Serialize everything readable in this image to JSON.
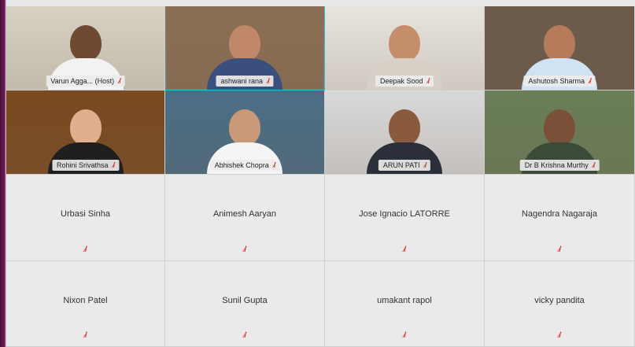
{
  "participants": [
    {
      "name": "Varun Agga... (Host)",
      "muted_icon": "mic-muted-icon",
      "video": true,
      "active": false,
      "bg": "#d8d2c4",
      "shirt": "#f2f2f2",
      "skin": "#6f4a33"
    },
    {
      "name": "ashwani rana",
      "muted_icon": "mic-muted-icon",
      "video": true,
      "active": true,
      "bg": "#8b6f55",
      "shirt": "#3b4f7d",
      "skin": "#c08868"
    },
    {
      "name": "Deepak Sood",
      "muted_icon": "mic-muted-icon",
      "video": true,
      "active": false,
      "bg": "#e7e4de",
      "shirt": "#d7d0c7",
      "skin": "#c58e6a"
    },
    {
      "name": "Ashutosh Sharma",
      "muted_icon": "mic-muted-icon",
      "video": true,
      "active": false,
      "bg": "#6c5a4b",
      "shirt": "#cfe3f5",
      "skin": "#b57b5b"
    },
    {
      "name": "Rohini Srivathsa",
      "muted_icon": "mic-muted-icon",
      "video": true,
      "active": false,
      "bg": "#7a4a20",
      "shirt": "#1f1f1f",
      "skin": "#e0b08e"
    },
    {
      "name": "Abhishek Chopra",
      "muted_icon": "mic-muted-icon",
      "video": true,
      "active": false,
      "bg": "#4b6e86",
      "shirt": "#f5f5f5",
      "skin": "#c89a78"
    },
    {
      "name": "ARUN PATI",
      "muted_icon": "mic-muted-icon",
      "video": true,
      "active": false,
      "bg": "#d9d9d9",
      "shirt": "#2a2f3a",
      "skin": "#8a5a3c"
    },
    {
      "name": "Dr B Krishna Murthy",
      "muted_icon": "mic-muted-icon",
      "video": true,
      "active": false,
      "bg": "#6a7e58",
      "shirt": "#3c4a3a",
      "skin": "#7a5038"
    },
    {
      "name": "Urbasi Sinha",
      "muted_icon": "mic-muted-icon",
      "video": false
    },
    {
      "name": "Animesh Aaryan",
      "muted_icon": "mic-muted-icon",
      "video": false
    },
    {
      "name": "Jose Ignacio LATORRE",
      "muted_icon": "mic-muted-icon",
      "video": false
    },
    {
      "name": "Nagendra Nagaraja",
      "muted_icon": "mic-muted-icon",
      "video": false
    },
    {
      "name": "Nixon Patel",
      "muted_icon": "mic-muted-icon",
      "video": false
    },
    {
      "name": "Sunil Gupta",
      "muted_icon": "mic-muted-icon",
      "video": false
    },
    {
      "name": "umakant rapol",
      "muted_icon": "mic-muted-icon",
      "video": false
    },
    {
      "name": "vicky pandita",
      "muted_icon": "mic-muted-icon",
      "video": false
    }
  ],
  "colors": {
    "active_border": "#33b4e6",
    "mic_muted": "#d8332a",
    "frame": "#5b1349"
  }
}
